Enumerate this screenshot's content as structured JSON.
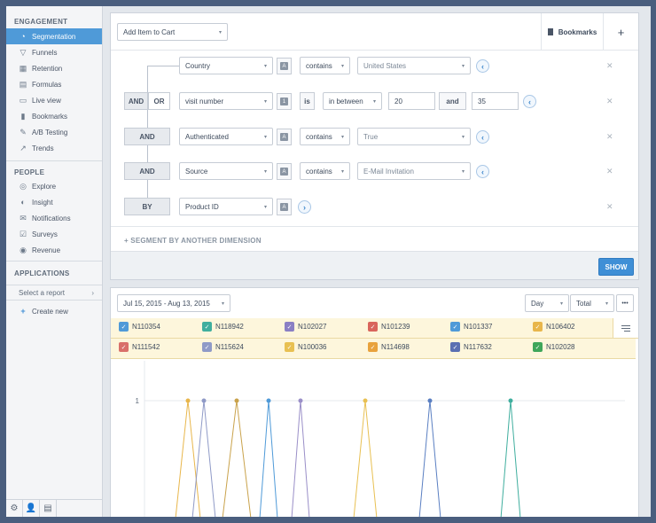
{
  "sidebar": {
    "engagement_title": "ENGAGEMENT",
    "engagement": [
      {
        "label": "Segmentation",
        "icon": "pie-icon"
      },
      {
        "label": "Funnels",
        "icon": "funnel-icon"
      },
      {
        "label": "Retention",
        "icon": "retention-icon"
      },
      {
        "label": "Formulas",
        "icon": "formula-icon"
      },
      {
        "label": "Live view",
        "icon": "live-icon"
      },
      {
        "label": "Bookmarks",
        "icon": "bookmark-icon"
      },
      {
        "label": "A/B Testing",
        "icon": "ab-icon"
      },
      {
        "label": "Trends",
        "icon": "trends-icon"
      }
    ],
    "people_title": "PEOPLE",
    "people": [
      {
        "label": "Explore",
        "icon": "explore-icon"
      },
      {
        "label": "Insight",
        "icon": "insight-icon"
      },
      {
        "label": "Notifications",
        "icon": "notifications-icon"
      },
      {
        "label": "Surveys",
        "icon": "surveys-icon"
      },
      {
        "label": "Revenue",
        "icon": "revenue-icon"
      }
    ],
    "applications_title": "APPLICATIONS",
    "select_report": "Select a report",
    "create_new": "Create new"
  },
  "query": {
    "event": "Add Item to Cart",
    "bookmarks": "Bookmarks",
    "add": "+",
    "and_label": "AND",
    "or_label": "OR",
    "by_label": "BY",
    "row1": {
      "property": "Country",
      "op": "contains",
      "value": "United States"
    },
    "row2": {
      "property": "visit number",
      "is": "is",
      "op": "in between",
      "from": "20",
      "and": "and",
      "to": "35"
    },
    "row3": {
      "property": "Authenticated",
      "op": "contains",
      "value": "True"
    },
    "row4": {
      "property": "Source",
      "op": "contains",
      "value": "E-Mail Invitation"
    },
    "row5": {
      "property": "Product ID"
    },
    "segment_link": "+ SEGMENT BY ANOTHER DIMENSION",
    "show": "SHOW"
  },
  "results": {
    "date_range": "Jul 15, 2015 - Aug 13, 2015",
    "interval": "Day",
    "measure": "Total",
    "more": "•••",
    "legend": [
      {
        "label": "N110354",
        "color": "#4f9ad8"
      },
      {
        "label": "N118942",
        "color": "#3fae9e"
      },
      {
        "label": "N102027",
        "color": "#8a7fc4"
      },
      {
        "label": "N101239",
        "color": "#d9655c"
      },
      {
        "label": "N101337",
        "color": "#4f9ad8"
      },
      {
        "label": "N106402",
        "color": "#e8b64b"
      },
      {
        "label": "N111542",
        "color": "#d9706a"
      },
      {
        "label": "N115624",
        "color": "#8f9ac7"
      },
      {
        "label": "N100036",
        "color": "#e8c052"
      },
      {
        "label": "N114698",
        "color": "#e8a23c"
      },
      {
        "label": "N117632",
        "color": "#5a6fb2"
      },
      {
        "label": "N102028",
        "color": "#3fa65a"
      }
    ],
    "ytick": "1"
  },
  "chart_data": {
    "type": "line",
    "ylabel": "",
    "ylim": [
      0,
      1.2
    ],
    "y_ticks": [
      "1"
    ],
    "series": [
      {
        "color": "#e8b64b",
        "peak": 1
      },
      {
        "color": "#8f9ac7",
        "peak": 1
      },
      {
        "color": "#c9a24b",
        "peak": 1
      },
      {
        "color": "#4f9ad8",
        "peak": 1
      },
      {
        "color": "#9a8fc8",
        "peak": 1
      },
      {
        "color": "#e8c052",
        "peak": 1
      },
      {
        "color": "#5a7fc2",
        "peak": 1
      },
      {
        "color": "#3fae9e",
        "peak": 1
      }
    ]
  }
}
